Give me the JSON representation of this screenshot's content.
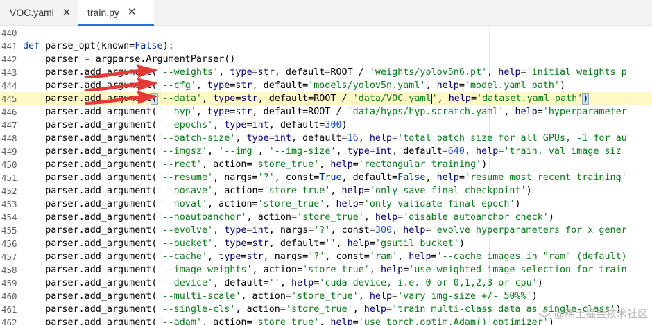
{
  "tabs": [
    {
      "label": "VOC.yaml",
      "active": false
    },
    {
      "label": "train.py",
      "active": true
    }
  ],
  "close_glyph": "✕",
  "colors": {
    "arrow": "#e53935",
    "tab_accent": "#1a73e8"
  },
  "editor": {
    "lines": [
      {
        "num": "440",
        "tokens": []
      },
      {
        "num": "441",
        "tokens": [
          [
            "kw",
            "def "
          ],
          [
            "",
            "parse_opt(known="
          ],
          [
            "kw",
            "False"
          ],
          [
            "",
            "):"
          ]
        ]
      },
      {
        "num": "442",
        "tokens": [
          [
            "",
            "    parser = argparse.ArgumentParser()"
          ]
        ]
      },
      {
        "num": "443",
        "tokens": [
          [
            "",
            "    parser.add_argument("
          ],
          [
            "str",
            "'--weights'"
          ],
          [
            "",
            ", "
          ],
          [
            "bi",
            "type"
          ],
          [
            "",
            "="
          ],
          [
            "bi",
            "str"
          ],
          [
            "",
            ", default=ROOT / "
          ],
          [
            "str",
            "'weights/yolov5n6.pt'"
          ],
          [
            "",
            ", "
          ],
          [
            "bi",
            "help"
          ],
          [
            "",
            "="
          ],
          [
            "str",
            "'initial weights p"
          ]
        ]
      },
      {
        "num": "444",
        "tokens": [
          [
            "",
            "    parser.add_argument("
          ],
          [
            "str",
            "'--cfg'"
          ],
          [
            "",
            ", "
          ],
          [
            "bi",
            "type"
          ],
          [
            "",
            "="
          ],
          [
            "bi",
            "str"
          ],
          [
            "",
            ", default="
          ],
          [
            "str",
            "'models/yolov5n.yaml'"
          ],
          [
            "",
            ", "
          ],
          [
            "bi",
            "help"
          ],
          [
            "",
            "="
          ],
          [
            "str",
            "'model.yaml path'"
          ],
          [
            "",
            ")"
          ]
        ]
      },
      {
        "num": "445",
        "highlight": true,
        "tokens": [
          [
            "",
            "    parser.add_argument"
          ],
          [
            "br",
            "("
          ],
          [
            "str",
            "'--data'"
          ],
          [
            "",
            ", "
          ],
          [
            "bi",
            "type"
          ],
          [
            "",
            "="
          ],
          [
            "bi",
            "str"
          ],
          [
            "",
            ", default=ROOT / "
          ],
          [
            "str",
            "'data/VOC.yaml"
          ],
          [
            "cur",
            ""
          ],
          [
            "str",
            "'"
          ],
          [
            "",
            ", "
          ],
          [
            "bi",
            "help"
          ],
          [
            "",
            "="
          ],
          [
            "str",
            "'dataset.yaml path'"
          ],
          [
            "br",
            ")"
          ]
        ]
      },
      {
        "num": "446",
        "tokens": [
          [
            "",
            "    parser.add_argument("
          ],
          [
            "str",
            "'--hyp'"
          ],
          [
            "",
            ", "
          ],
          [
            "bi",
            "type"
          ],
          [
            "",
            "="
          ],
          [
            "bi",
            "str"
          ],
          [
            "",
            ", default=ROOT / "
          ],
          [
            "str",
            "'data/hyps/hyp.scratch.yaml'"
          ],
          [
            "",
            ", "
          ],
          [
            "bi",
            "help"
          ],
          [
            "",
            "="
          ],
          [
            "str",
            "'hyperparameter"
          ]
        ]
      },
      {
        "num": "447",
        "tokens": [
          [
            "",
            "    parser.add_argument("
          ],
          [
            "str",
            "'--epochs'"
          ],
          [
            "",
            ", "
          ],
          [
            "bi",
            "type"
          ],
          [
            "",
            "="
          ],
          [
            "bi",
            "int"
          ],
          [
            "",
            ", default="
          ],
          [
            "num",
            "300"
          ],
          [
            "",
            ")"
          ]
        ]
      },
      {
        "num": "448",
        "tokens": [
          [
            "",
            "    parser.add_argument("
          ],
          [
            "str",
            "'--batch-size'"
          ],
          [
            "",
            ", "
          ],
          [
            "bi",
            "type"
          ],
          [
            "",
            "="
          ],
          [
            "bi",
            "int"
          ],
          [
            "",
            ", default="
          ],
          [
            "num",
            "16"
          ],
          [
            "",
            ", "
          ],
          [
            "bi",
            "help"
          ],
          [
            "",
            "="
          ],
          [
            "str",
            "'total batch size for all GPUs, -1 for au"
          ]
        ]
      },
      {
        "num": "449",
        "tokens": [
          [
            "",
            "    parser.add_argument("
          ],
          [
            "str",
            "'--imgsz'"
          ],
          [
            "",
            ", "
          ],
          [
            "str",
            "'--img'"
          ],
          [
            "",
            ", "
          ],
          [
            "str",
            "'--img-size'"
          ],
          [
            "",
            ", "
          ],
          [
            "bi",
            "type"
          ],
          [
            "",
            "="
          ],
          [
            "bi",
            "int"
          ],
          [
            "",
            ", default="
          ],
          [
            "num",
            "640"
          ],
          [
            "",
            ", "
          ],
          [
            "bi",
            "help"
          ],
          [
            "",
            "="
          ],
          [
            "str",
            "'train, val image siz"
          ]
        ]
      },
      {
        "num": "450",
        "tokens": [
          [
            "",
            "    parser.add_argument("
          ],
          [
            "str",
            "'--rect'"
          ],
          [
            "",
            ", action="
          ],
          [
            "str",
            "'store_true'"
          ],
          [
            "",
            ", "
          ],
          [
            "bi",
            "help"
          ],
          [
            "",
            "="
          ],
          [
            "str",
            "'rectangular training'"
          ],
          [
            "",
            ")"
          ]
        ]
      },
      {
        "num": "451",
        "tokens": [
          [
            "",
            "    parser.add_argument("
          ],
          [
            "str",
            "'--resume'"
          ],
          [
            "",
            ", nargs="
          ],
          [
            "str",
            "'?'"
          ],
          [
            "",
            ", const="
          ],
          [
            "kw",
            "True"
          ],
          [
            "",
            ", default="
          ],
          [
            "kw",
            "False"
          ],
          [
            "",
            ", "
          ],
          [
            "bi",
            "help"
          ],
          [
            "",
            "="
          ],
          [
            "str",
            "'resume most recent training'"
          ]
        ]
      },
      {
        "num": "452",
        "tokens": [
          [
            "",
            "    parser.add_argument("
          ],
          [
            "str",
            "'--nosave'"
          ],
          [
            "",
            ", action="
          ],
          [
            "str",
            "'store_true'"
          ],
          [
            "",
            ", "
          ],
          [
            "bi",
            "help"
          ],
          [
            "",
            "="
          ],
          [
            "str",
            "'only save final checkpoint'"
          ],
          [
            "",
            ")"
          ]
        ]
      },
      {
        "num": "453",
        "tokens": [
          [
            "",
            "    parser.add_argument("
          ],
          [
            "str",
            "'--noval'"
          ],
          [
            "",
            ", action="
          ],
          [
            "str",
            "'store_true'"
          ],
          [
            "",
            ", "
          ],
          [
            "bi",
            "help"
          ],
          [
            "",
            "="
          ],
          [
            "str",
            "'only validate final epoch'"
          ],
          [
            "",
            ")"
          ]
        ]
      },
      {
        "num": "454",
        "tokens": [
          [
            "",
            "    parser.add_argument("
          ],
          [
            "str",
            "'--noautoanchor'"
          ],
          [
            "",
            ", action="
          ],
          [
            "str",
            "'store_true'"
          ],
          [
            "",
            ", "
          ],
          [
            "bi",
            "help"
          ],
          [
            "",
            "="
          ],
          [
            "str",
            "'disable autoanchor check'"
          ],
          [
            "",
            ")"
          ]
        ]
      },
      {
        "num": "455",
        "tokens": [
          [
            "",
            "    parser.add_argument("
          ],
          [
            "str",
            "'--evolve'"
          ],
          [
            "",
            ", "
          ],
          [
            "bi",
            "type"
          ],
          [
            "",
            "="
          ],
          [
            "bi",
            "int"
          ],
          [
            "",
            ", nargs="
          ],
          [
            "str",
            "'?'"
          ],
          [
            "",
            ", const="
          ],
          [
            "num",
            "300"
          ],
          [
            "",
            ", "
          ],
          [
            "bi",
            "help"
          ],
          [
            "",
            "="
          ],
          [
            "str",
            "'evolve hyperparameters for x gener"
          ]
        ]
      },
      {
        "num": "456",
        "tokens": [
          [
            "",
            "    parser.add_argument("
          ],
          [
            "str",
            "'--bucket'"
          ],
          [
            "",
            ", "
          ],
          [
            "bi",
            "type"
          ],
          [
            "",
            "="
          ],
          [
            "bi",
            "str"
          ],
          [
            "",
            ", default="
          ],
          [
            "str",
            "''"
          ],
          [
            "",
            ", "
          ],
          [
            "bi",
            "help"
          ],
          [
            "",
            "="
          ],
          [
            "str",
            "'gsutil bucket'"
          ],
          [
            "",
            ")"
          ]
        ]
      },
      {
        "num": "457",
        "tokens": [
          [
            "",
            "    parser.add_argument("
          ],
          [
            "str",
            "'--cache'"
          ],
          [
            "",
            ", "
          ],
          [
            "bi",
            "type"
          ],
          [
            "",
            "="
          ],
          [
            "bi",
            "str"
          ],
          [
            "",
            ", nargs="
          ],
          [
            "str",
            "'?'"
          ],
          [
            "",
            ", const="
          ],
          [
            "str",
            "'ram'"
          ],
          [
            "",
            ", "
          ],
          [
            "bi",
            "help"
          ],
          [
            "",
            "="
          ],
          [
            "str",
            "'--cache images in \"ram\" (default)"
          ]
        ]
      },
      {
        "num": "458",
        "tokens": [
          [
            "",
            "    parser.add_argument("
          ],
          [
            "str",
            "'--image-weights'"
          ],
          [
            "",
            ", action="
          ],
          [
            "str",
            "'store_true'"
          ],
          [
            "",
            ", "
          ],
          [
            "bi",
            "help"
          ],
          [
            "",
            "="
          ],
          [
            "str",
            "'use weighted image selection for train"
          ]
        ]
      },
      {
        "num": "459",
        "tokens": [
          [
            "",
            "    parser.add_argument("
          ],
          [
            "str",
            "'--device'"
          ],
          [
            "",
            ", default="
          ],
          [
            "str",
            "''"
          ],
          [
            "",
            ", "
          ],
          [
            "bi",
            "help"
          ],
          [
            "",
            "="
          ],
          [
            "str",
            "'cuda device, i.e. 0 or 0,1,2,3 or cpu'"
          ],
          [
            "",
            ")"
          ]
        ]
      },
      {
        "num": "460",
        "tokens": [
          [
            "",
            "    parser.add_argument("
          ],
          [
            "str",
            "'--multi-scale'"
          ],
          [
            "",
            ", action="
          ],
          [
            "str",
            "'store_true'"
          ],
          [
            "",
            ", "
          ],
          [
            "bi",
            "help"
          ],
          [
            "",
            "="
          ],
          [
            "str",
            "'vary img-size +/- 50%%'"
          ],
          [
            "",
            ")"
          ]
        ]
      },
      {
        "num": "461",
        "tokens": [
          [
            "",
            "    parser.add_argument("
          ],
          [
            "str",
            "'--single-cls'"
          ],
          [
            "",
            ", action="
          ],
          [
            "str",
            "'store_true'"
          ],
          [
            "",
            ", "
          ],
          [
            "bi",
            "help"
          ],
          [
            "",
            "="
          ],
          [
            "str",
            "'train multi-class data as single-class'"
          ],
          [
            "",
            ")"
          ]
        ]
      },
      {
        "num": "462",
        "tokens": [
          [
            "",
            "    parser.add_argument("
          ],
          [
            "str",
            "'--adam'"
          ],
          [
            "",
            ", action="
          ],
          [
            "str",
            "'store_true'"
          ],
          [
            "",
            ", "
          ],
          [
            "bi",
            "help"
          ],
          [
            "",
            "="
          ],
          [
            "str",
            "'use torch.optim.Adam() optimizer'"
          ],
          [
            "",
            ")"
          ]
        ]
      }
    ]
  },
  "watermark": {
    "text": "@稀土掘金技术社区",
    "icon": "juejin-logo-icon"
  }
}
